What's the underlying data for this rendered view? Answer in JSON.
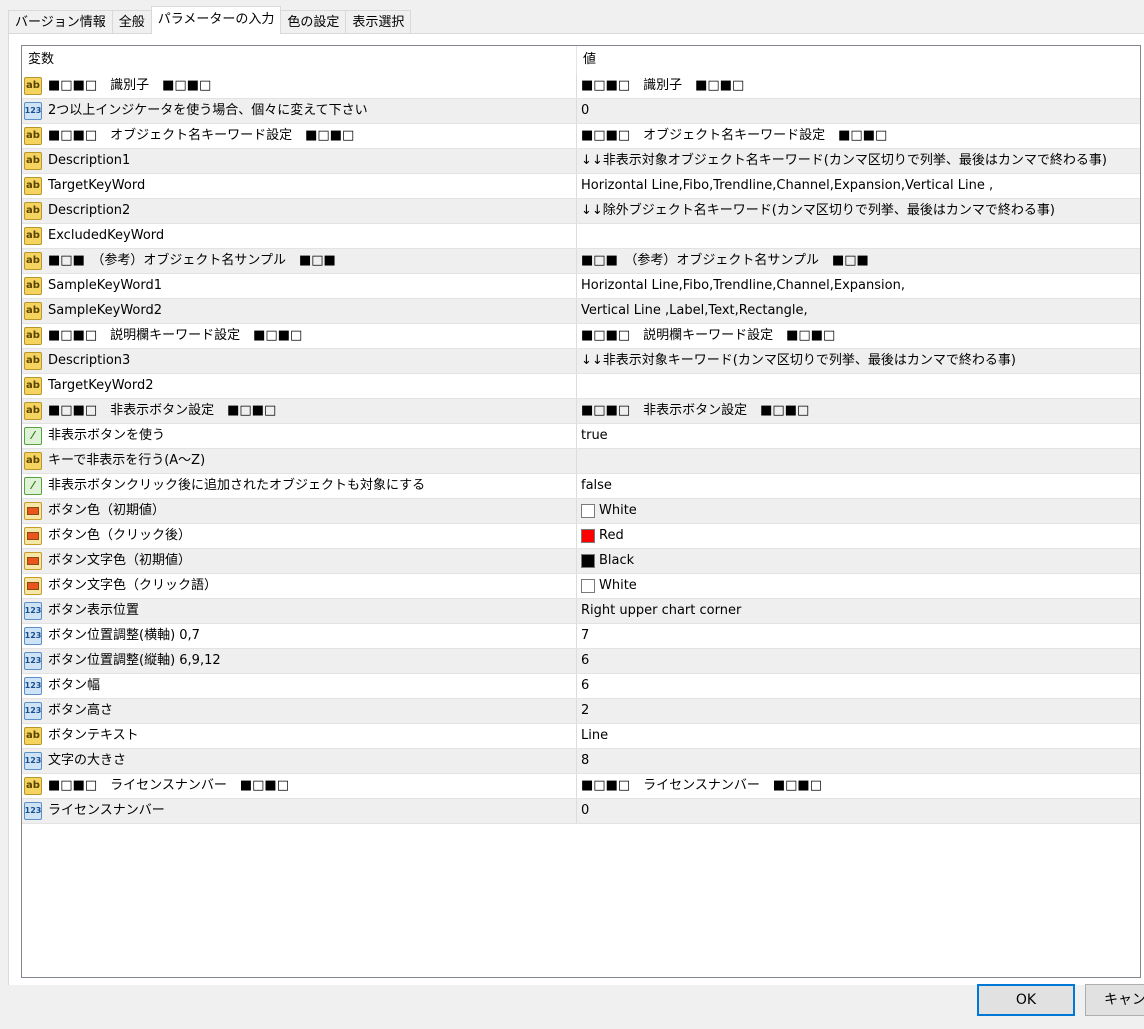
{
  "tabs": [
    "バージョン情報",
    "全般",
    "パラメーターの入力",
    "色の設定",
    "表示選択"
  ],
  "active_tab": 2,
  "grid": {
    "header": {
      "variable": "変数",
      "value": "値"
    },
    "rows": [
      {
        "icon": "ab",
        "name": "■□■□　識別子　■□■□",
        "value": "■□■□　識別子　■□■□"
      },
      {
        "icon": "num",
        "name": "2つ以上インジケータを使う場合、個々に変えて下さい",
        "value": "0"
      },
      {
        "icon": "ab",
        "name": "■□■□　オブジェクト名キーワード設定　■□■□",
        "value": "■□■□　オブジェクト名キーワード設定　■□■□"
      },
      {
        "icon": "ab",
        "name": "Description1",
        "value": "↓↓非表示対象オブジェクト名キーワード(カンマ区切りで列挙、最後はカンマで終わる事)"
      },
      {
        "icon": "ab",
        "name": "TargetKeyWord",
        "value": "Horizontal Line,Fibo,Trendline,Channel,Expansion,Vertical Line ,"
      },
      {
        "icon": "ab",
        "name": "Description2",
        "value": "↓↓除外ブジェクト名キーワード(カンマ区切りで列挙、最後はカンマで終わる事)"
      },
      {
        "icon": "ab",
        "name": "ExcludedKeyWord",
        "value": ""
      },
      {
        "icon": "ab",
        "name": "■□■　（参考）オブジェクト名サンプル　■□■",
        "value": "■□■　（参考）オブジェクト名サンプル　■□■"
      },
      {
        "icon": "ab",
        "name": "SampleKeyWord1",
        "value": "Horizontal Line,Fibo,Trendline,Channel,Expansion,"
      },
      {
        "icon": "ab",
        "name": "SampleKeyWord2",
        "value": "Vertical Line ,Label,Text,Rectangle,"
      },
      {
        "icon": "ab",
        "name": "■□■□　説明欄キーワード設定　■□■□",
        "value": "■□■□　説明欄キーワード設定　■□■□"
      },
      {
        "icon": "ab",
        "name": "Description3",
        "value": "↓↓非表示対象キーワード(カンマ区切りで列挙、最後はカンマで終わる事)"
      },
      {
        "icon": "ab",
        "name": "TargetKeyWord2",
        "value": ""
      },
      {
        "icon": "ab",
        "name": "■□■□　非表示ボタン設定　■□■□",
        "value": "■□■□　非表示ボタン設定　■□■□"
      },
      {
        "icon": "bool",
        "name": "非表示ボタンを使う",
        "value": "true"
      },
      {
        "icon": "ab",
        "name": "キーで非表示を行う(A～Z)",
        "value": ""
      },
      {
        "icon": "bool",
        "name": "非表示ボタンクリック後に追加されたオブジェクトも対象にする",
        "value": "false"
      },
      {
        "icon": "color",
        "name": "ボタン色（初期値）",
        "value": "White",
        "swatch": "#ffffff"
      },
      {
        "icon": "color",
        "name": "ボタン色（クリック後）",
        "value": "Red",
        "swatch": "#ff0000"
      },
      {
        "icon": "color",
        "name": "ボタン文字色（初期値）",
        "value": "Black",
        "swatch": "#000000"
      },
      {
        "icon": "color",
        "name": "ボタン文字色（クリック語）",
        "value": "White",
        "swatch": "#ffffff"
      },
      {
        "icon": "num",
        "name": "ボタン表示位置",
        "value": "Right upper chart corner"
      },
      {
        "icon": "num",
        "name": "ボタン位置調整(横軸) 0,7",
        "value": "7"
      },
      {
        "icon": "num",
        "name": "ボタン位置調整(縦軸) 6,9,12",
        "value": "6"
      },
      {
        "icon": "num",
        "name": "ボタン幅",
        "value": "6"
      },
      {
        "icon": "num",
        "name": "ボタン高さ",
        "value": "2"
      },
      {
        "icon": "ab",
        "name": "ボタンテキスト",
        "value": "Line"
      },
      {
        "icon": "num",
        "name": "文字の大きさ",
        "value": "8"
      },
      {
        "icon": "ab",
        "name": "■□■□　ライセンスナンバー　■□■□",
        "value": "■□■□　ライセンスナンバー　■□■□"
      },
      {
        "icon": "num",
        "name": "ライセンスナンバー",
        "value": "0"
      }
    ]
  },
  "buttons": {
    "ok": "OK",
    "cancel": "キャンセ"
  }
}
